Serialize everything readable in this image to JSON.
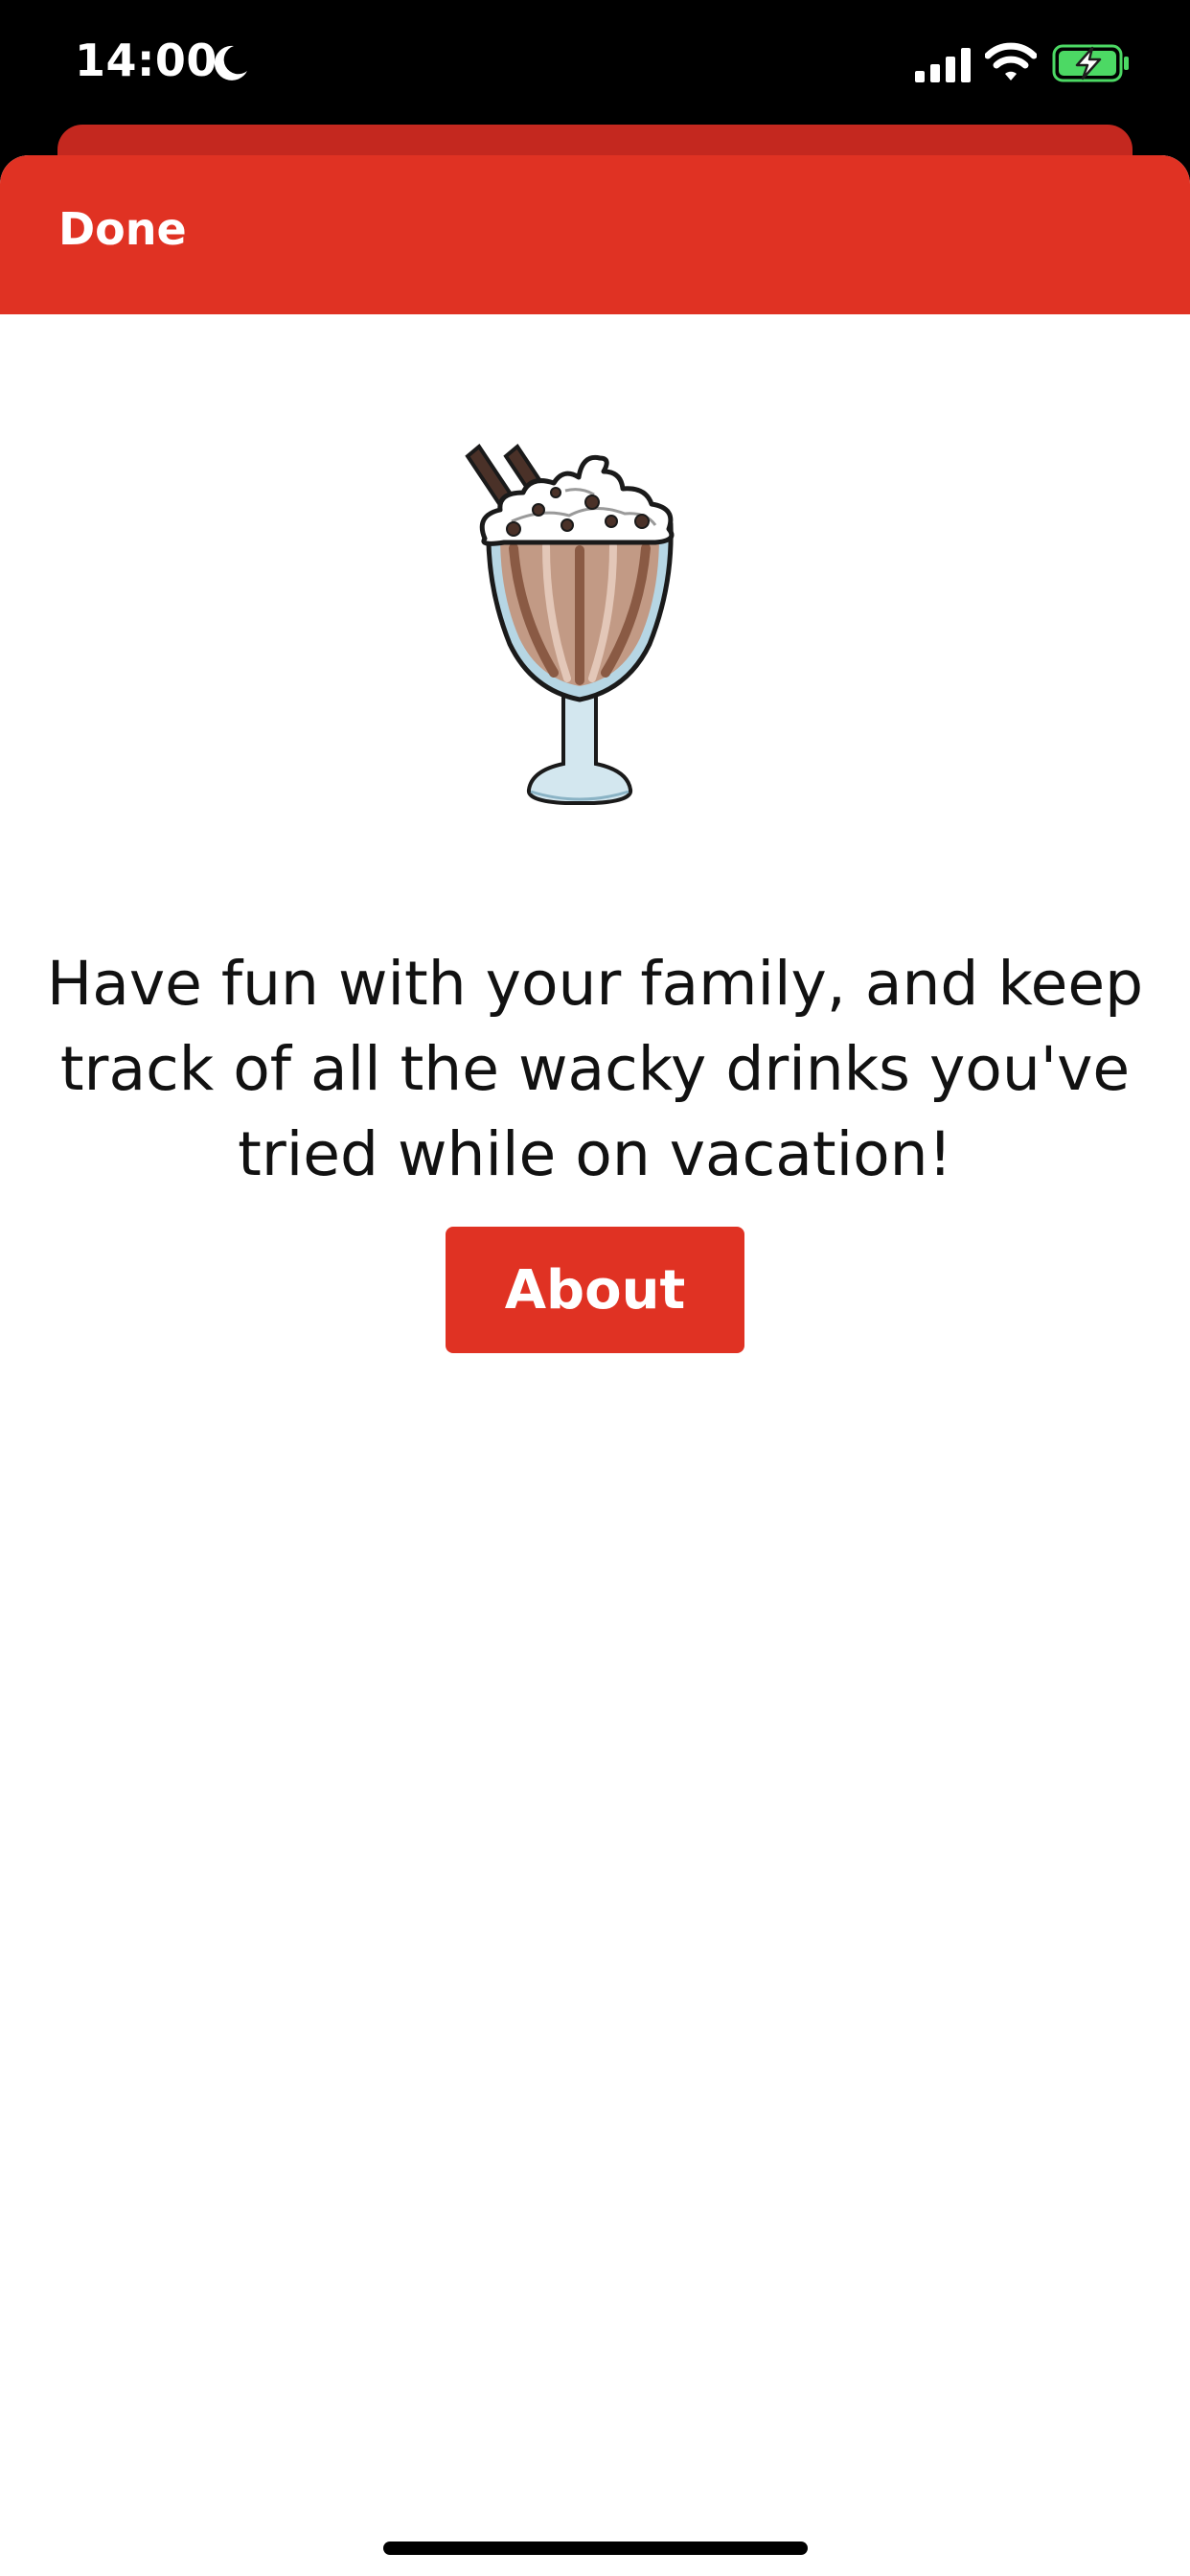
{
  "status_bar": {
    "time": "14:00",
    "icons": [
      "moon-icon",
      "cellular-signal-icon",
      "wifi-icon",
      "battery-charging-icon"
    ]
  },
  "nav": {
    "done_label": "Done"
  },
  "main": {
    "illustration": "milkshake-icon",
    "tagline": "Have fun with your family, and keep track of all the wacky drinks you've tried while on vacation!",
    "about_label": "About"
  },
  "colors": {
    "accent": "#e03223",
    "accent_dark": "#c4281f",
    "battery": "#4cd964",
    "background": "#ffffff"
  }
}
